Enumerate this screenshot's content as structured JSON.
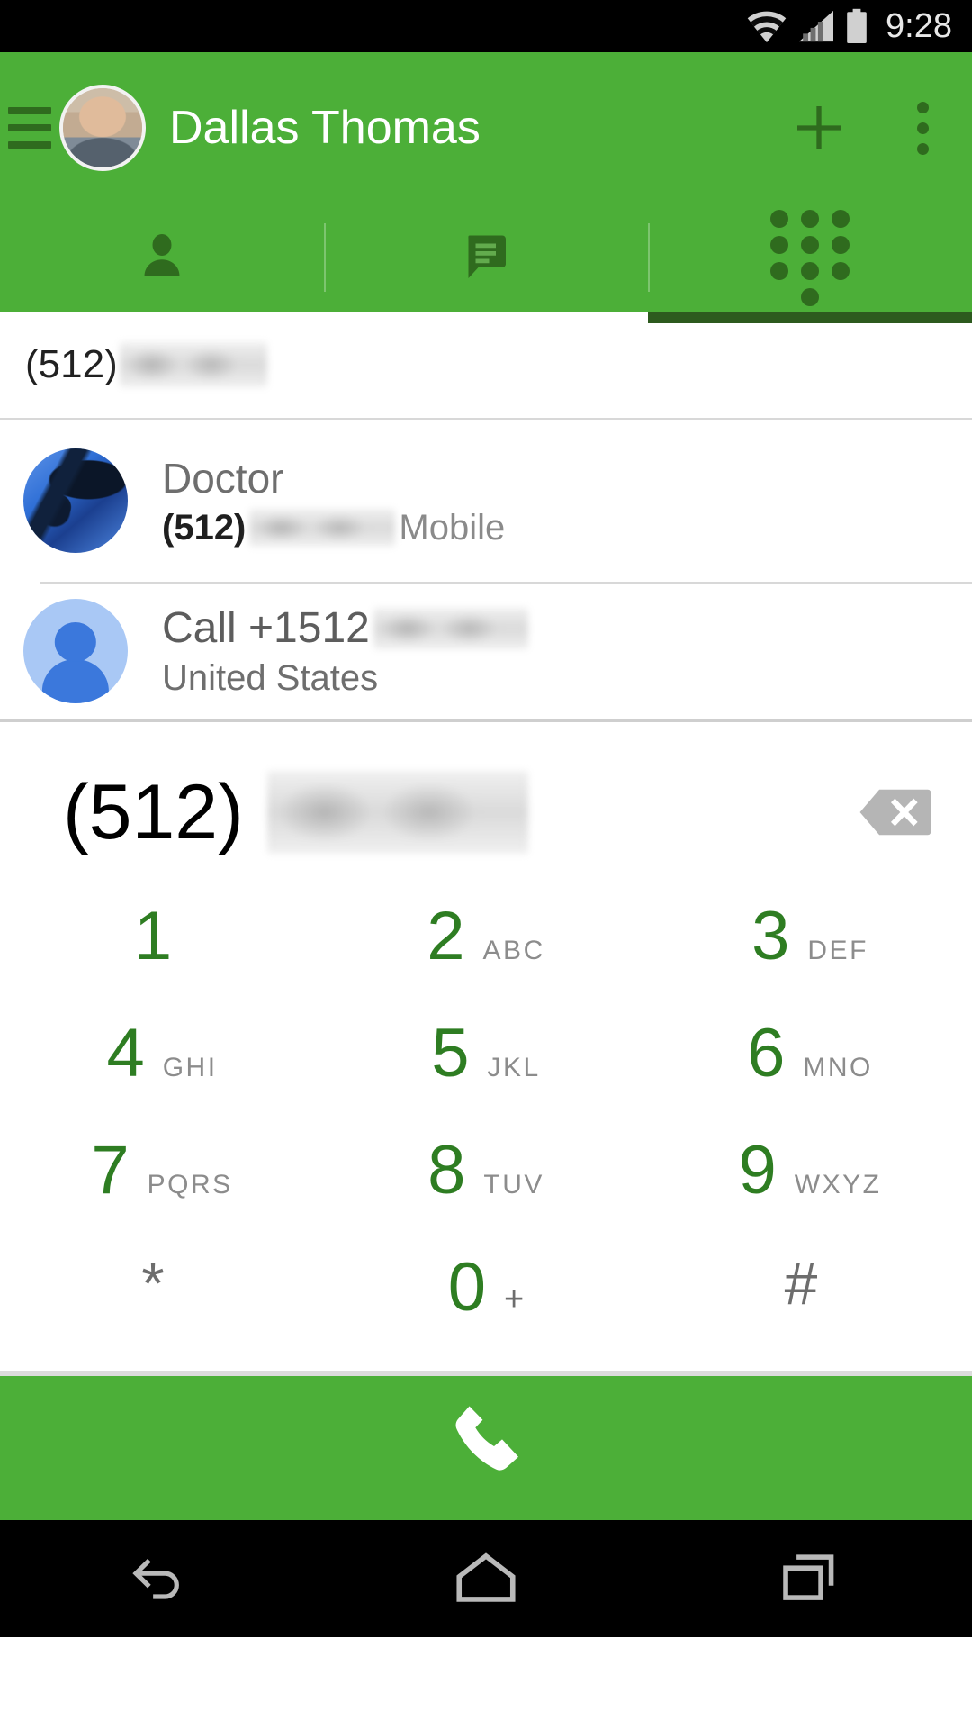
{
  "status_bar": {
    "time": "9:28",
    "icons": [
      "wifi-icon",
      "signal-icon",
      "battery-icon"
    ]
  },
  "app_bar": {
    "menu_icon": "hamburger-menu-icon",
    "avatar": "user-avatar",
    "title": "Dallas Thomas",
    "add_icon": "plus-icon",
    "overflow_icon": "overflow-menu-icon",
    "background_color": "#4caf38"
  },
  "tabs": [
    {
      "name": "contacts",
      "icon": "person-icon",
      "active": false
    },
    {
      "name": "messages",
      "icon": "speech-bubble-icon",
      "active": false
    },
    {
      "name": "dialpad",
      "icon": "dialpad-dots-icon",
      "active": true
    }
  ],
  "tab_indicator_color": "#2d5a1e",
  "suggestions": {
    "prefix_row": {
      "text": "(512)",
      "redacted": true
    },
    "contacts": [
      {
        "name": "Doctor",
        "avatar": "doctor-stethoscope-photo",
        "number_prefix": "(512)",
        "number_redacted": true,
        "label": "Mobile"
      },
      {
        "name": "Call +1512",
        "avatar": "default-person-avatar",
        "number_redacted": true,
        "label": "United States"
      }
    ]
  },
  "number_entry": {
    "value": "(512)",
    "redacted": true,
    "delete_icon": "backspace-icon"
  },
  "keypad": {
    "rows": [
      [
        {
          "digit": "1",
          "letters": ""
        },
        {
          "digit": "2",
          "letters": "ABC"
        },
        {
          "digit": "3",
          "letters": "DEF"
        }
      ],
      [
        {
          "digit": "4",
          "letters": "GHI"
        },
        {
          "digit": "5",
          "letters": "JKL"
        },
        {
          "digit": "6",
          "letters": "MNO"
        }
      ],
      [
        {
          "digit": "7",
          "letters": "PQRS"
        },
        {
          "digit": "8",
          "letters": "TUV"
        },
        {
          "digit": "9",
          "letters": "WXYZ"
        }
      ],
      [
        {
          "digit": "*",
          "letters": "",
          "gray": true
        },
        {
          "digit": "0",
          "letters": "+"
        },
        {
          "digit": "#",
          "letters": "",
          "gray": true
        }
      ]
    ],
    "digit_color": "#2e7d22",
    "letter_color": "#8c8c8c"
  },
  "call_bar": {
    "icon": "phone-handset-icon",
    "background_color": "#4caf38"
  },
  "nav_bar": {
    "back_icon": "back-arrow-icon",
    "home_icon": "home-icon",
    "recents_icon": "recent-apps-icon"
  }
}
